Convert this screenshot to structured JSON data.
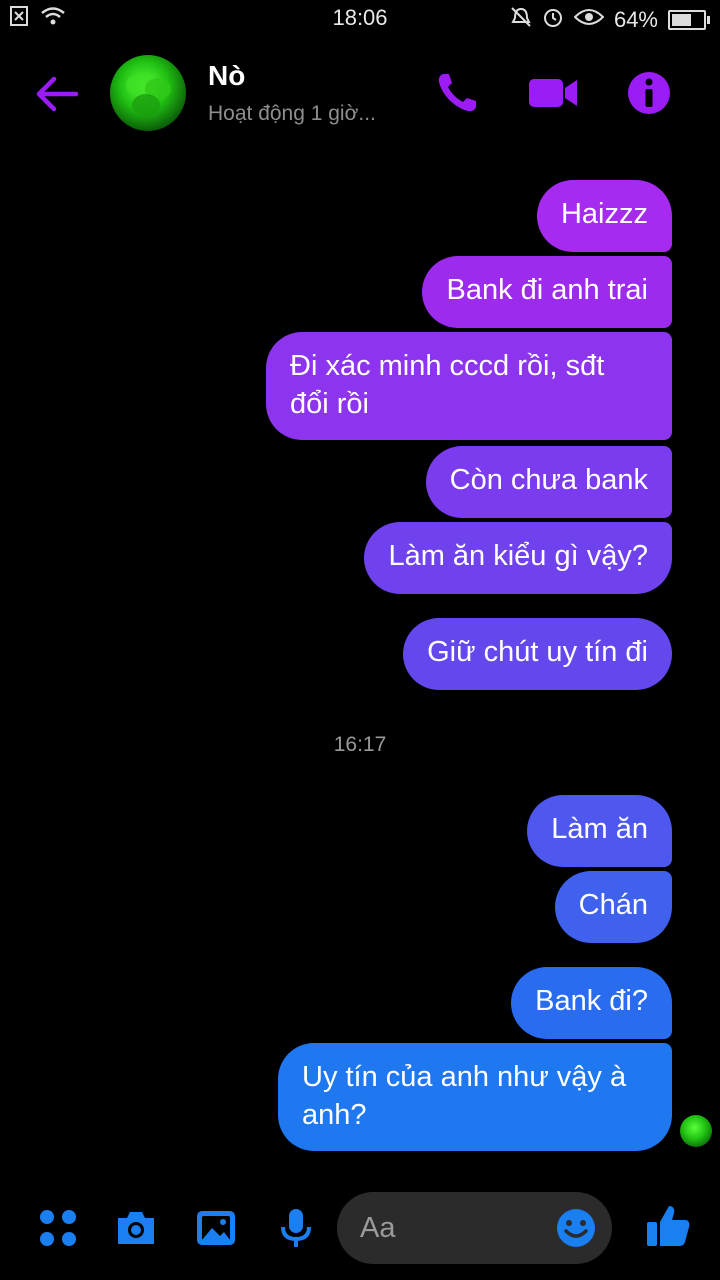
{
  "status_bar": {
    "time": "18:06",
    "battery": "64%",
    "battery_level": 0.64
  },
  "header": {
    "name": "Nò",
    "presence": "Hoạt động 1 giờ..."
  },
  "messages_group1": [
    "Haizzz",
    "Bank đi anh trai",
    "Đi xác minh cccd rồi,  sđt đổi rồi",
    "Còn chưa bank",
    "Làm ăn kiểu gì vậy?",
    "Giữ chút uy tín đi"
  ],
  "timestamp": "16:17",
  "messages_group2": [
    "Làm ăn",
    "Chán",
    "Bank đi?",
    "Uy tín của anh như vậy à anh?"
  ],
  "composer": {
    "placeholder": "Aa"
  },
  "colors": {
    "accent": "#9b1cf5",
    "bubble_purple": "#8a2be2",
    "bubble_blue": "#1f78f0",
    "composer_blue": "#1a7ff0"
  },
  "icons": [
    "back-arrow-icon",
    "phone-icon",
    "video-icon",
    "info-icon",
    "apps-icon",
    "camera-icon",
    "image-icon",
    "mic-icon",
    "emoji-icon",
    "like-icon"
  ]
}
